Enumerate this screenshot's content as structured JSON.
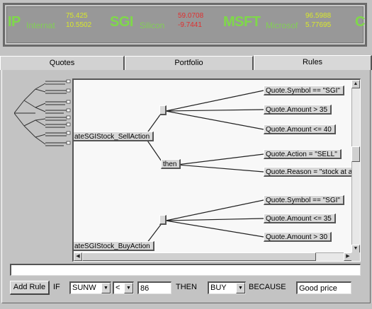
{
  "ticker": [
    {
      "symbol": "IP",
      "name": "Internat",
      "price": "75.425",
      "change": "10.5502",
      "change_dir": "up"
    },
    {
      "symbol": "SGI",
      "name": "Silicon",
      "price": "59.0708",
      "change": "-9.7441",
      "change_dir": "down"
    },
    {
      "symbol": "MSFT",
      "name": "Microsof",
      "price": "96.5988",
      "change": "5.77695",
      "change_dir": "up"
    },
    {
      "symbol": "C",
      "name": "",
      "price": "",
      "change": "",
      "change_dir": "up"
    }
  ],
  "colors": {
    "ticker_green": "#7fd84a",
    "ticker_up": "#d8e82a",
    "ticker_down": "#e03030"
  },
  "tabs": [
    {
      "label": "Quotes",
      "active": false
    },
    {
      "label": "Portfolio",
      "active": false
    },
    {
      "label": "Rules",
      "active": true
    }
  ],
  "rules": {
    "sell_action": "ateSGIStock_SellAction",
    "buy_action": "ateSGIStock_BuyAction",
    "if_node": "if",
    "then_node": "then",
    "sell_conditions": [
      "Quote.Symbol == \"SGI\"",
      "Quote.Amount > 35",
      "Quote.Amount <= 40"
    ],
    "sell_results": [
      "Quote.Action = \"SELL\"",
      "Quote.Reason = \"stock at a"
    ],
    "buy_conditions": [
      "Quote.Symbol == \"SGI\"",
      "Quote.Amount <= 35",
      "Quote.Amount > 30"
    ]
  },
  "status_text": "",
  "builder": {
    "add_rule_label": "Add Rule",
    "if_label": "IF",
    "symbol_value": "SUNW",
    "operator_value": "<",
    "amount_value": "86",
    "then_label": "THEN",
    "action_value": "BUY",
    "because_label": "BECAUSE",
    "reason_value": "Good price"
  },
  "icons": {
    "scroll_up": "▲",
    "scroll_down": "▼",
    "scroll_left": "◀",
    "scroll_right": "▶",
    "dropdown": "▼"
  }
}
